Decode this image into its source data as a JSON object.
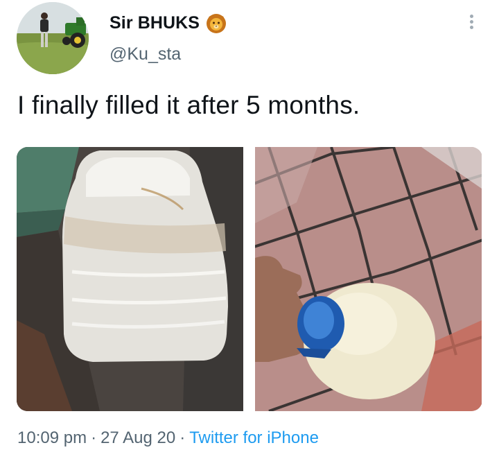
{
  "user": {
    "display_name": "Sir BHUKS",
    "badge_icon": "lion-face-icon",
    "handle": "@Ku_sta"
  },
  "tweet": {
    "text": "I finally filled it after 5 months."
  },
  "media": {
    "count": 2,
    "items": [
      {
        "subject": "bottle-photo-side-view"
      },
      {
        "subject": "bottle-photo-top-view"
      }
    ]
  },
  "meta": {
    "time": "10:09 pm",
    "date": "27 Aug 20",
    "separator": "·",
    "source": "Twitter for iPhone"
  },
  "colors": {
    "text": "#0f1419",
    "secondary": "#536471",
    "link": "#1d9bf0"
  }
}
